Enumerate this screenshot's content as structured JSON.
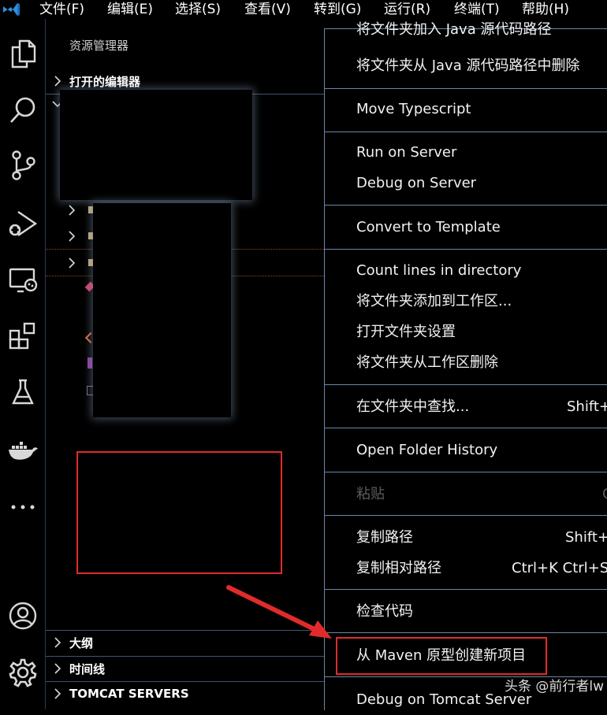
{
  "menubar": {
    "items": [
      "文件(F)",
      "编辑(E)",
      "选择(S)",
      "查看(V)",
      "转到(G)",
      "运行(R)",
      "终端(T)",
      "帮助(H)"
    ]
  },
  "activity_icons": [
    "explorer-icon",
    "search-icon",
    "source-control-icon",
    "run-debug-icon",
    "remote-explorer-icon",
    "extensions-icon",
    "testing-icon",
    "docker-icon",
    "more-icon",
    "account-icon",
    "settings-gear-icon"
  ],
  "sidebar": {
    "title": "资源管理器",
    "open_editors": "打开的编辑器",
    "outline": "大纲",
    "timeline": "时间线",
    "tomcat": "TOMCAT SERVERS"
  },
  "context_menu": {
    "items": [
      {
        "label": "将文件夹加入 Java 源代码路径",
        "shortcut": ""
      },
      {
        "label": "将文件夹从 Java 源代码路径中删除",
        "shortcut": ""
      },
      {
        "label": "Move Typescript",
        "shortcut": ""
      },
      {
        "label": "Run on Server",
        "shortcut": ""
      },
      {
        "label": "Debug on Server",
        "shortcut": ""
      },
      {
        "label": "Convert to Template",
        "shortcut": ""
      },
      {
        "label": "Count lines in directory",
        "shortcut": ""
      },
      {
        "label": "将文件夹添加到工作区...",
        "shortcut": ""
      },
      {
        "label": "打开文件夹设置",
        "shortcut": ""
      },
      {
        "label": "将文件夹从工作区删除",
        "shortcut": ""
      },
      {
        "label": "在文件夹中查找...",
        "shortcut": "Shift+"
      },
      {
        "label": "Open Folder History",
        "shortcut": ""
      },
      {
        "label": "粘贴",
        "shortcut": "C",
        "disabled": true
      },
      {
        "label": "复制路径",
        "shortcut": "Shift+"
      },
      {
        "label": "复制相对路径",
        "shortcut": "Ctrl+K Ctrl+Sh"
      },
      {
        "label": "检查代码",
        "shortcut": ""
      },
      {
        "label": "从 Maven 原型创建新项目",
        "shortcut": ""
      },
      {
        "label": "Debug on Tomcat Server",
        "shortcut": ""
      }
    ]
  },
  "watermark": "头条 @前行者lw",
  "colors": {
    "highlight_border": "#e12b2b",
    "menu_border": "#6b87a8"
  }
}
